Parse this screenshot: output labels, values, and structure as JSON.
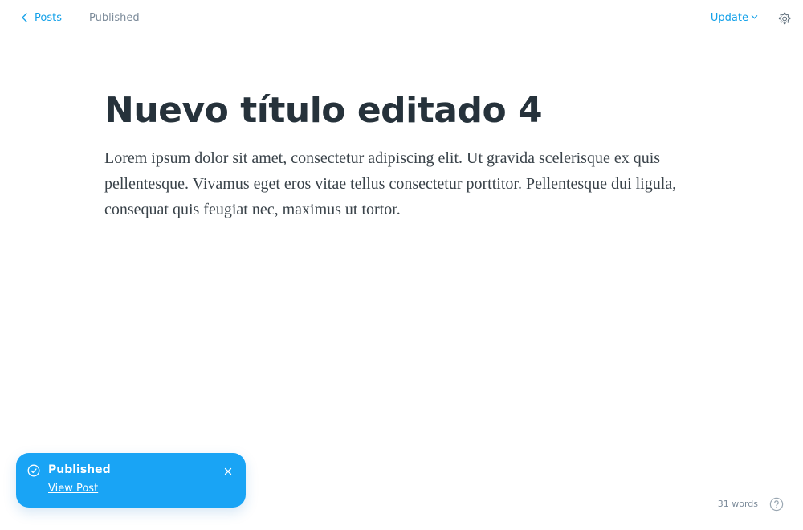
{
  "header": {
    "back_label": "Posts",
    "status": "Published",
    "update_label": "Update"
  },
  "post": {
    "title": "Nuevo título editado 4",
    "body": "Lorem ipsum dolor sit amet, consectetur adipiscing elit. Ut gravida scelerisque ex quis pellentesque. Vivamus eget eros vitae tellus consectetur porttitor. Pellentesque dui ligula, consequat quis feugiat nec, maximus ut tortor."
  },
  "toast": {
    "title": "Published",
    "link_label": "View Post"
  },
  "footer": {
    "word_count": "31 words"
  },
  "icons": {
    "back": "chevron-left-icon",
    "update_caret": "chevron-down-icon",
    "settings": "gear-icon",
    "toast_status": "check-circle-icon",
    "toast_close": "close-icon",
    "help": "question-circle-icon"
  },
  "colors": {
    "accent": "#14a1e9",
    "toast_bg": "#19a4f5",
    "muted_text": "#7c8b9a",
    "title_text": "#26323b"
  }
}
